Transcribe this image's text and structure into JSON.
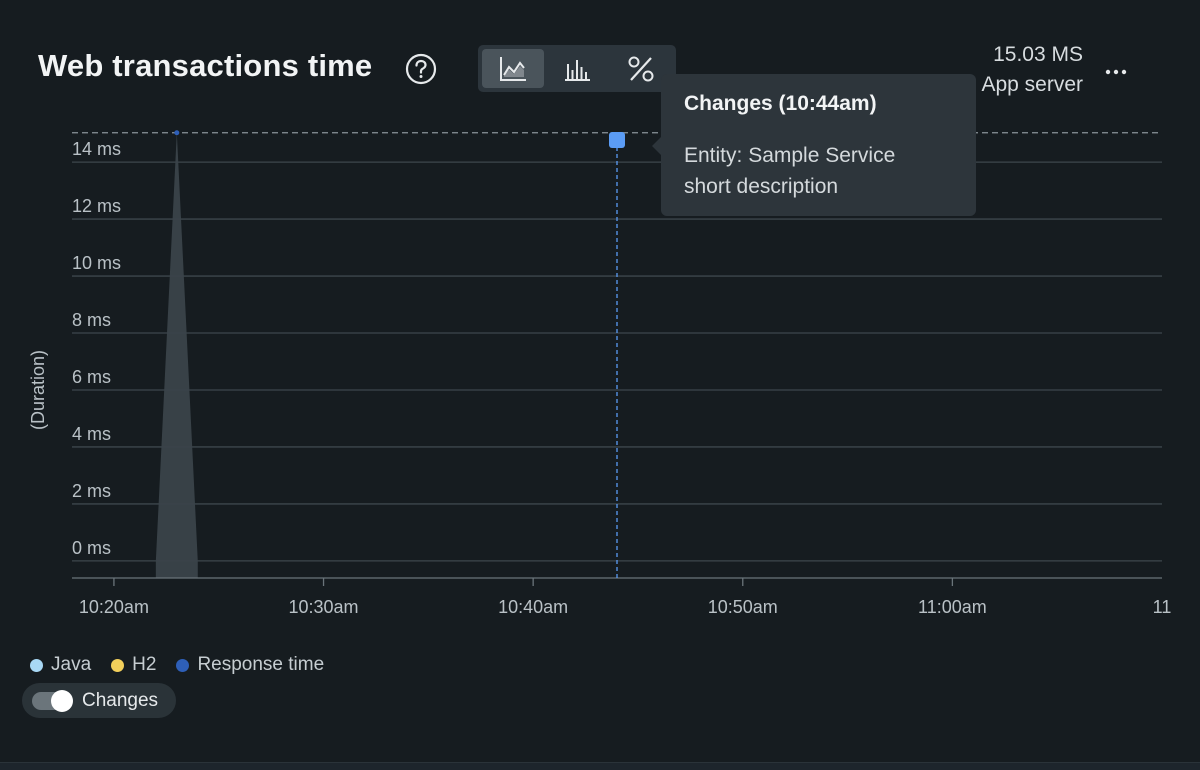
{
  "header": {
    "title": "Web transactions time",
    "summary_value": "15.03 MS",
    "summary_label": "App server"
  },
  "view_modes": [
    {
      "icon": "area-chart-icon",
      "active": true
    },
    {
      "icon": "bar-chart-icon",
      "active": false
    },
    {
      "icon": "percent-icon",
      "active": false
    }
  ],
  "tooltip": {
    "title": "Changes (10:44am)",
    "line1": "Entity: Sample Service",
    "line2": "short description"
  },
  "legend": [
    {
      "label": "Java",
      "color": "#a8d8f5"
    },
    {
      "label": "H2",
      "color": "#f2cf5b"
    },
    {
      "label": "Response time",
      "color": "#2e5fb8"
    }
  ],
  "changes_toggle": {
    "label": "Changes",
    "on": true
  },
  "chart_data": {
    "type": "area",
    "ylabel": "(Duration)",
    "y_ticks": [
      {
        "value": 0,
        "label": "0 ms"
      },
      {
        "value": 2,
        "label": "2 ms"
      },
      {
        "value": 4,
        "label": "4 ms"
      },
      {
        "value": 6,
        "label": "6 ms"
      },
      {
        "value": 8,
        "label": "8 ms"
      },
      {
        "value": 10,
        "label": "10 ms"
      },
      {
        "value": 12,
        "label": "12 ms"
      },
      {
        "value": 14,
        "label": "14 ms"
      }
    ],
    "ylim": [
      -0.6,
      14.6
    ],
    "threshold": 15.03,
    "x_ticks": [
      {
        "value": "10:20",
        "label": "10:20am"
      },
      {
        "value": "10:30",
        "label": "10:30am"
      },
      {
        "value": "10:40",
        "label": "10:40am"
      },
      {
        "value": "10:50",
        "label": "10:50am"
      },
      {
        "value": "11:00",
        "label": "11:00am"
      },
      {
        "value": "11:10",
        "label": "11"
      }
    ],
    "xlim": [
      "10:18",
      "11:10"
    ],
    "series": [
      {
        "name": "Response time",
        "color": "#3a434a",
        "x": [
          "10:22",
          "10:23",
          "10:24"
        ],
        "y": [
          0,
          15.03,
          0
        ]
      }
    ],
    "change_marker": {
      "time": "10:44",
      "color": "#5b9cf5"
    },
    "grid": true
  }
}
